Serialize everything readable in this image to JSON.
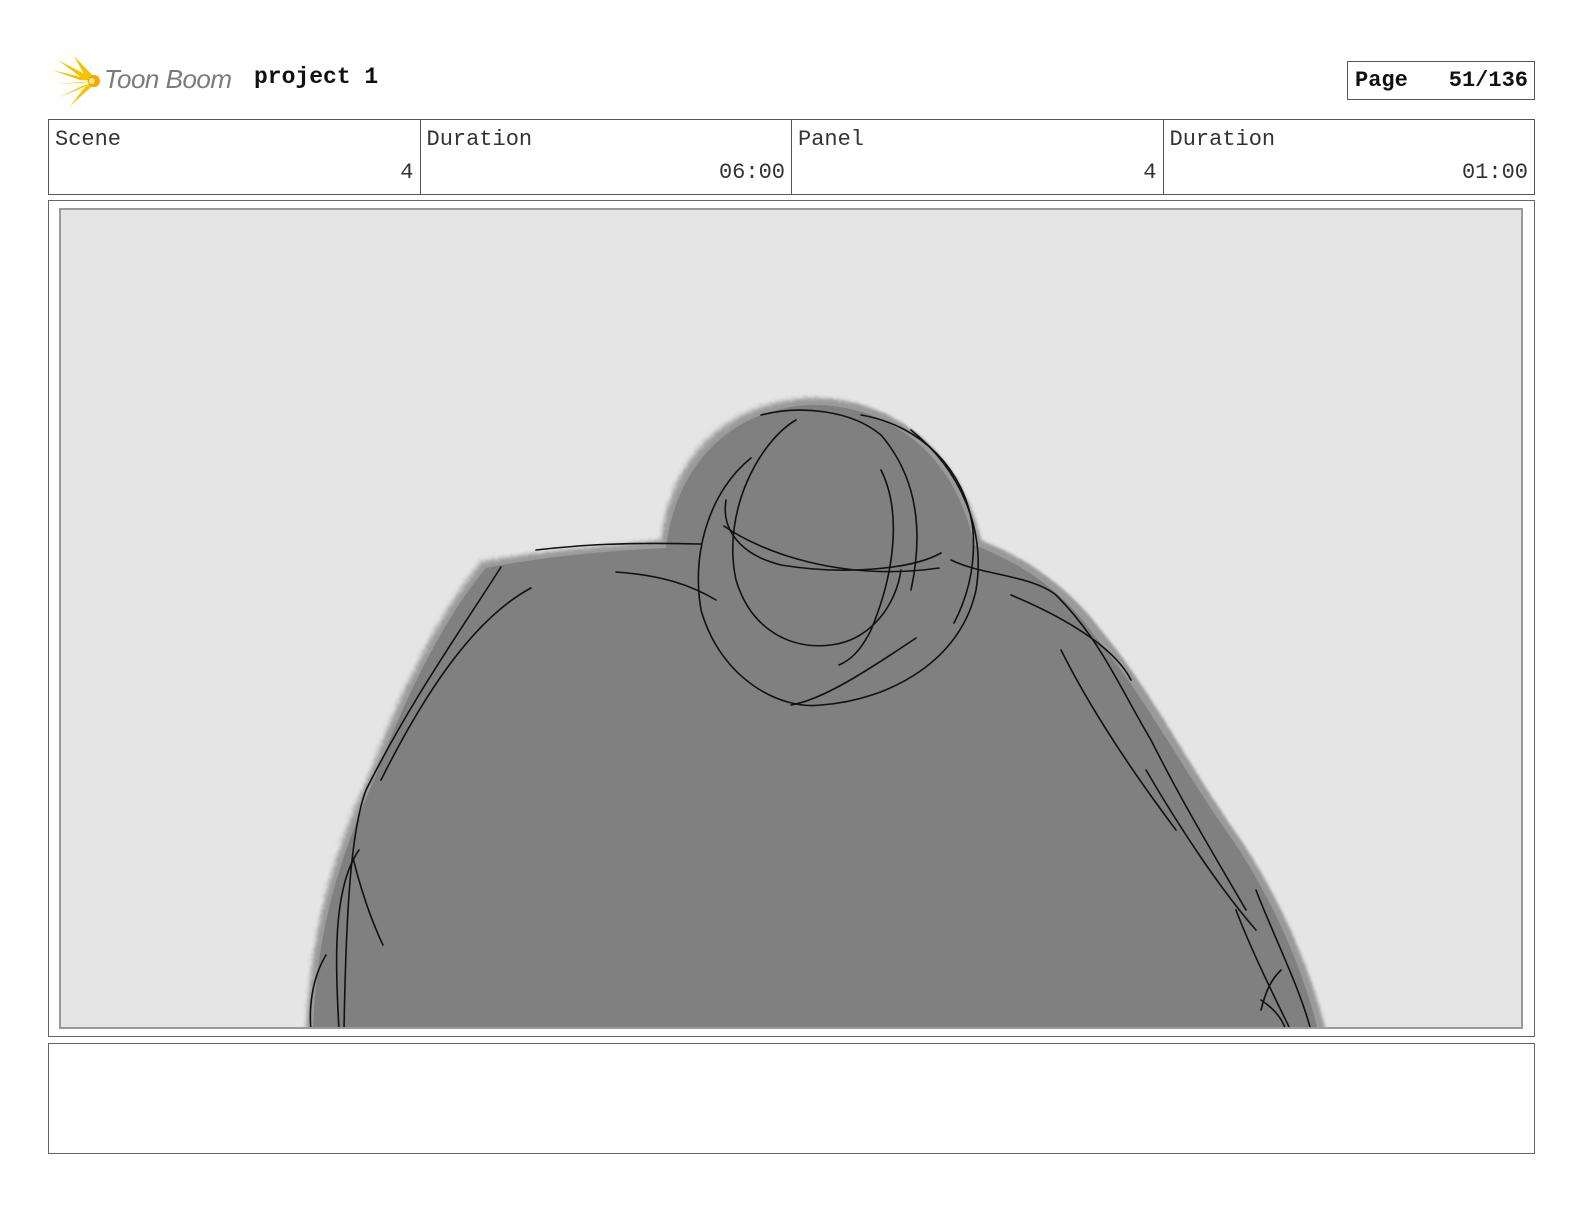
{
  "header": {
    "logo_text": "Toon Boom",
    "project_title": "project 1",
    "page_label": "Page",
    "page_number": "51/136"
  },
  "info": {
    "scene_label": "Scene",
    "scene_value": "4",
    "scene_duration_label": "Duration",
    "scene_duration_value": "06:00",
    "panel_label": "Panel",
    "panel_value": "4",
    "panel_duration_label": "Duration",
    "panel_duration_value": "01:00"
  },
  "panel": {
    "background_color": "#e5e5e5",
    "figure_color": "#808080",
    "stroke_color": "#111111"
  },
  "notes": {
    "text": ""
  }
}
